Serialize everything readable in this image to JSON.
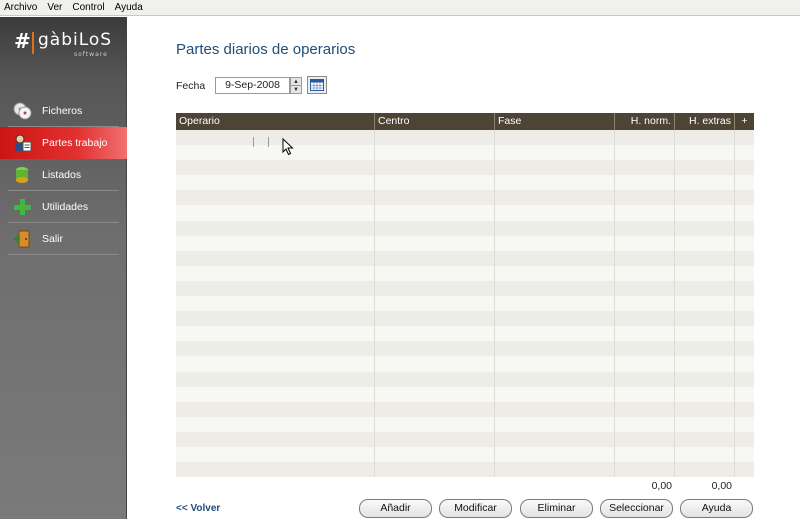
{
  "menu": [
    "Archivo",
    "Ver",
    "Control",
    "Ayuda"
  ],
  "logo": {
    "name": "gàbiLoS",
    "subtitle": "software"
  },
  "sidebar": {
    "items": [
      {
        "label": "Ficheros",
        "icon": "disks-icon",
        "active": false
      },
      {
        "label": "Partes trabajo",
        "icon": "worker-icon",
        "active": true
      },
      {
        "label": "Listados",
        "icon": "stack-icon",
        "active": false
      },
      {
        "label": "Utilidades",
        "icon": "plus-icon",
        "active": false
      },
      {
        "label": "Salir",
        "icon": "exit-door-icon",
        "active": false
      }
    ]
  },
  "main": {
    "title": "Partes diarios de operarios",
    "fecha_label": "Fecha",
    "fecha_value": "9-Sep-2008"
  },
  "grid": {
    "columns": [
      "Operario",
      "Centro",
      "Fase",
      "H. norm.",
      "H. extras",
      "+"
    ],
    "row_count": 23,
    "totals": {
      "h_norm": "0,00",
      "h_extras": "0,00"
    }
  },
  "footer": {
    "volver": "<< Volver",
    "buttons": [
      "Añadir",
      "Modificar",
      "Eliminar",
      "Seleccionar",
      "Ayuda"
    ]
  },
  "colors": {
    "accent_red": "#cc1414",
    "title_blue": "#1f4e7a",
    "grid_header": "#4d4435"
  }
}
